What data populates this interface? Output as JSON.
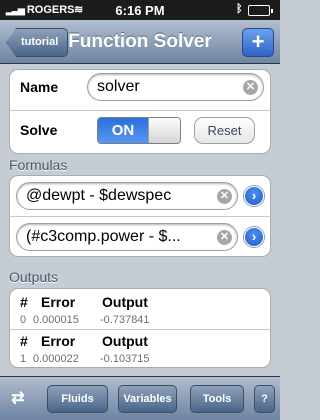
{
  "status_bar": {
    "carrier": "ROGERS",
    "time": "6:16 PM",
    "icons": [
      "signal-bars-icon",
      "wifi-icon",
      "bluetooth-icon",
      "battery-icon"
    ]
  },
  "navbar": {
    "back_label": "tutorial",
    "title": "Function Solver",
    "add_label": "+"
  },
  "settings": {
    "name_label": "Name",
    "name_value": "solver",
    "solve_label": "Solve",
    "switch_on_label": "ON",
    "switch_state": true,
    "reset_label": "Reset"
  },
  "formulas": {
    "heading": "Formulas",
    "items": [
      {
        "value": "@dewpt - $dewspec"
      },
      {
        "value": "(#c3comp.power - $..."
      }
    ]
  },
  "outputs": {
    "heading": "Outputs",
    "columns": [
      "#",
      "Error",
      "Output"
    ],
    "rows": [
      {
        "index": "0",
        "error": "0.000015",
        "output": "-0.737841"
      },
      {
        "index": "1",
        "error": "0.000022",
        "output": "-0.103715"
      }
    ]
  },
  "toolbar": {
    "icon": "flow-diagram-icon",
    "fluids_label": "Fluids",
    "variables_label": "Variables",
    "tools_label": "Tools",
    "help_label": "?"
  },
  "colors": {
    "accent": "#2b6fdc",
    "nav_bar": "#6d84a2",
    "background": "#c5ccd4"
  }
}
